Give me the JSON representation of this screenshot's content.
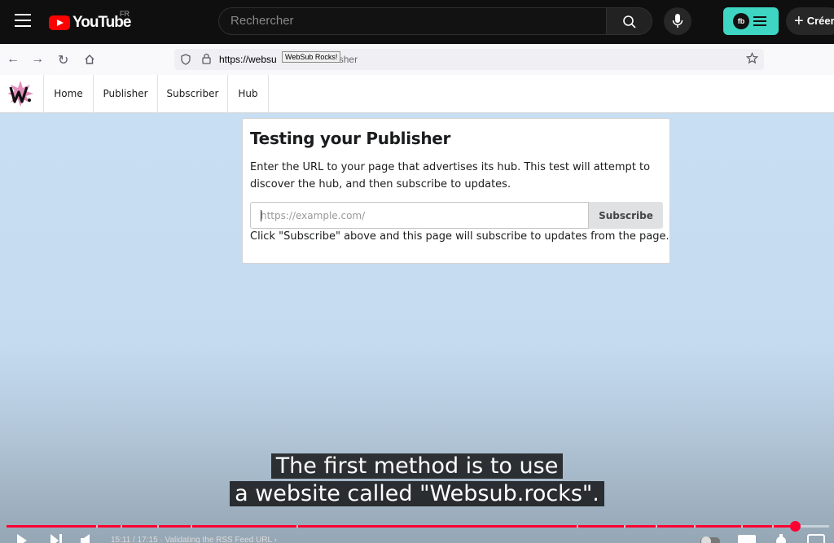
{
  "youtube": {
    "logo_text": "YouTube",
    "country": "FR",
    "search_placeholder": "Rechercher",
    "extension_badge": "fb",
    "create_label": "Créer"
  },
  "browser": {
    "url_host": "https://websu",
    "url_rest": "sher",
    "tooltip": "WebSub Rocks!"
  },
  "site": {
    "nav": [
      "Home",
      "Publisher",
      "Subscriber",
      "Hub"
    ]
  },
  "card": {
    "title": "Testing your Publisher",
    "description": "Enter the URL to your page that advertises its hub. This test will attempt to discover the hub, and then subscribe to updates.",
    "input_placeholder": "https://example.com/",
    "button_label": "Subscribe",
    "note": "Click \"Subscribe\" above and this page will subscribe to updates from the page."
  },
  "subtitles": {
    "line1": "The first method is to use",
    "line2": "a website called \"Websub.rocks\"."
  },
  "player": {
    "progress_fraction": 0.958,
    "time_text": "15:11 / 17:15 · Validating the RSS Feed URL ›"
  },
  "colors": {
    "youtube_red": "#ff0000",
    "progress_red": "#ff0033",
    "extension_teal": "#3ed6c3",
    "video_background": "#c9dff3"
  }
}
